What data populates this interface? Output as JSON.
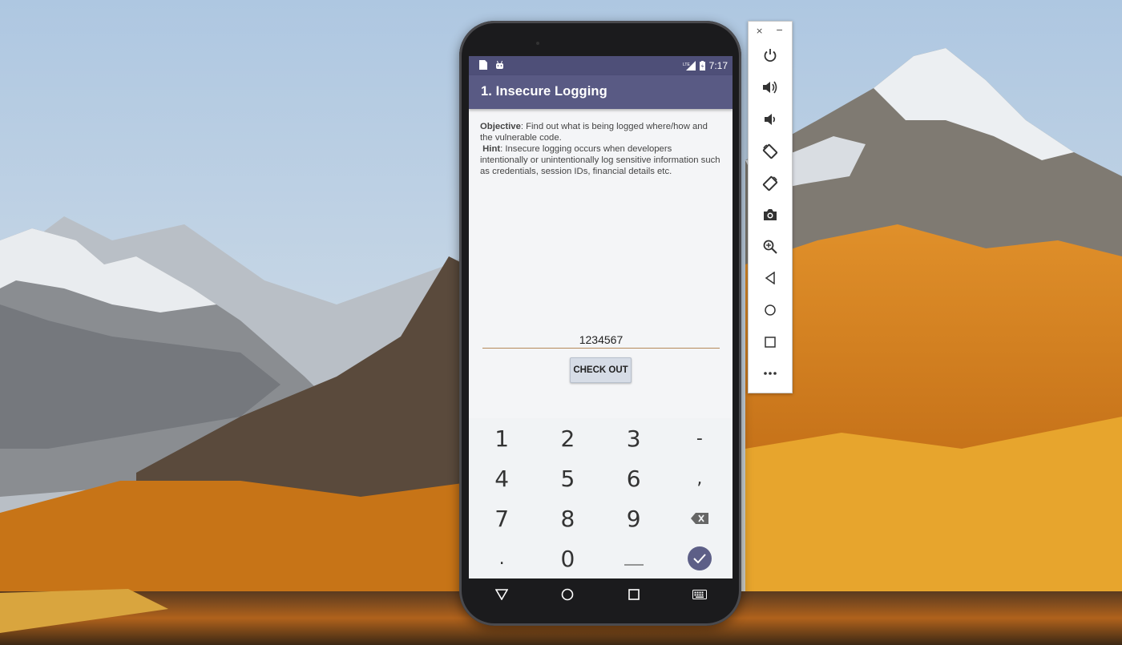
{
  "app": {
    "title": "1. Insecure Logging",
    "accent_color": "#595a84",
    "statusbar_color": "#4e4f78"
  },
  "statusbar": {
    "time": "7:17",
    "network": "LTE",
    "icons": [
      "sd-card-icon",
      "android-icon",
      "signal-icon",
      "battery-charging-icon"
    ]
  },
  "content": {
    "objective_label": "Objective",
    "objective_text": ": Find out what is being logged where/how and the vulnerable code.",
    "hint_label": "Hint",
    "hint_text": ": Insecure logging occurs when developers intentionally or unintentionally log sensitive information such as credentials, session IDs, financial details etc.",
    "input_value": "1234567",
    "checkout_label": "CHECK OUT"
  },
  "keyboard": {
    "keys": [
      "1",
      "2",
      "3",
      "-",
      "4",
      "5",
      "6",
      ",",
      "7",
      "8",
      "9",
      "backspace",
      ".",
      "0",
      "space",
      "done"
    ]
  },
  "navbar": {
    "buttons": [
      "back-icon",
      "home-icon",
      "recents-icon",
      "keyboard-icon"
    ]
  },
  "emulator_toolbar": {
    "close": "×",
    "minimize": "−",
    "buttons": [
      "power",
      "volume-up",
      "volume-down",
      "rotate-left",
      "rotate-right",
      "screenshot",
      "zoom",
      "back",
      "home",
      "overview",
      "more"
    ]
  }
}
